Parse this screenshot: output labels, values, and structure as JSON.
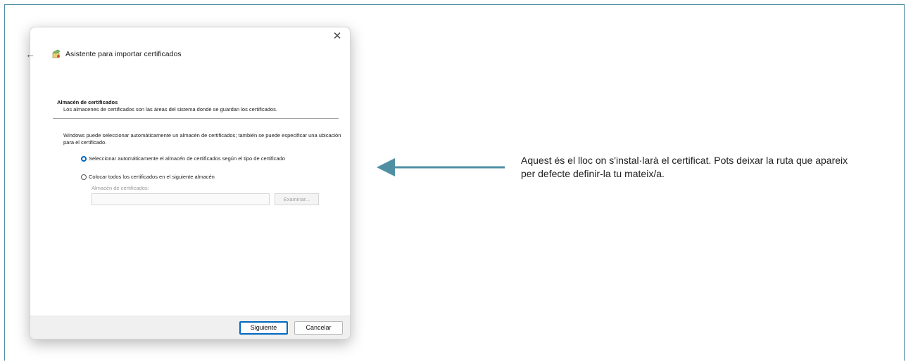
{
  "dialog": {
    "close_glyph": "✕",
    "back_glyph": "←",
    "title": "Asistente para importar certificados",
    "section_heading": "Almacén de certificados",
    "section_description": "Los almacenes de certificados son las áreas del sistema donde se guardan los certificados.",
    "info_text": "Windows puede seleccionar automáticamente un almacén de certificados; también se puede especificar una ubicación para el certificado.",
    "options": [
      {
        "label": "Seleccionar automáticamente el almacén de certificados según el tipo de certificado",
        "selected": true
      },
      {
        "label": "Colocar todos los certificados en el siguiente almacén",
        "selected": false
      }
    ],
    "store_label": "Almacén de certificados:",
    "store_value": "",
    "browse_label": "Examinar...",
    "next_label": "Siguiente",
    "cancel_label": "Cancelar"
  },
  "annotation": {
    "text": "Aquest és el lloc on s'instal·larà el certificat. Pots deixar la ruta que apareix per defecte definir-la tu mateix/a.",
    "arrow_color": "#4f8fa3"
  },
  "colors": {
    "accent": "#0067c0",
    "frame": "#4f8fa3"
  }
}
